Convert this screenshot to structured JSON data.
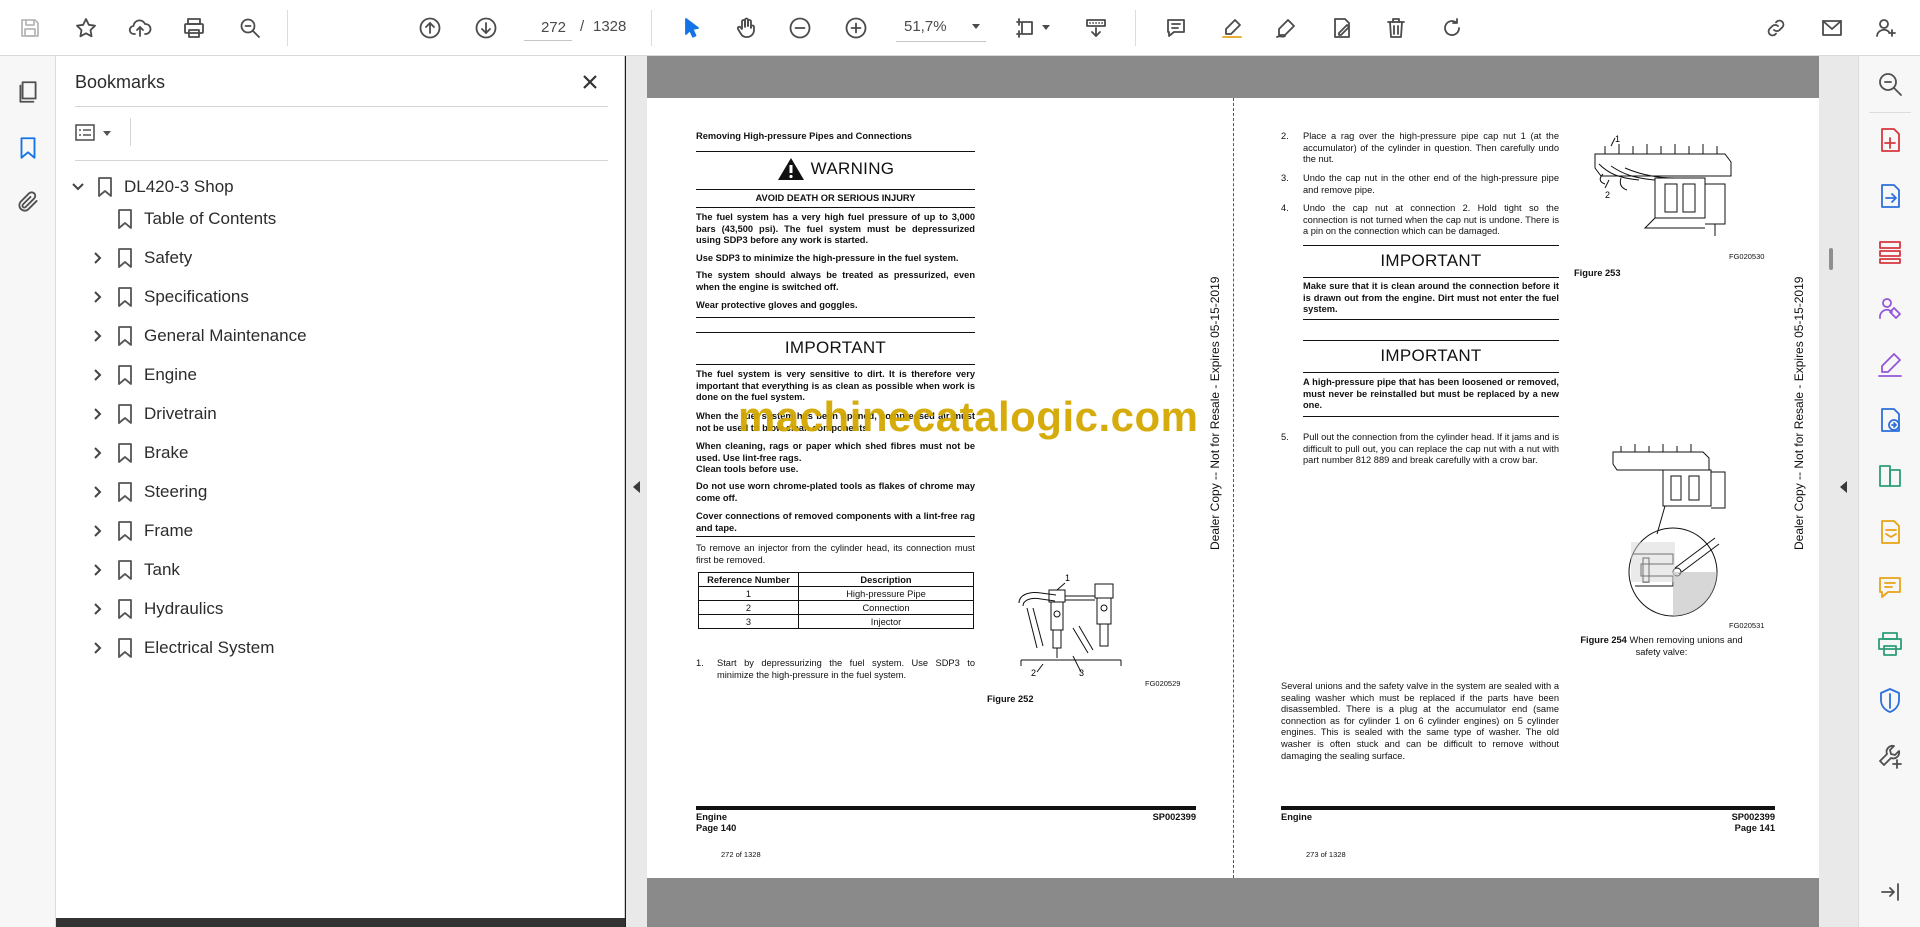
{
  "toolbar": {
    "current_page": "272",
    "page_separator": "/",
    "total_pages": "1328",
    "zoom": "51,7%"
  },
  "bookmarks": {
    "title": "Bookmarks",
    "root": "DL420-3 Shop",
    "items": [
      {
        "label": "Table of Contents",
        "expandable": false
      },
      {
        "label": "Safety",
        "expandable": true
      },
      {
        "label": "Specifications",
        "expandable": true
      },
      {
        "label": "General Maintenance",
        "expandable": true
      },
      {
        "label": "Engine",
        "expandable": true
      },
      {
        "label": "Drivetrain",
        "expandable": true
      },
      {
        "label": "Brake",
        "expandable": true
      },
      {
        "label": "Steering",
        "expandable": true
      },
      {
        "label": "Frame",
        "expandable": true
      },
      {
        "label": "Tank",
        "expandable": true
      },
      {
        "label": "Hydraulics",
        "expandable": true
      },
      {
        "label": "Electrical System",
        "expandable": true
      }
    ]
  },
  "watermark": "machinecatalogic.com",
  "page_left": {
    "section_title": "Removing High-pressure Pipes and Connections",
    "warning_title": "WARNING",
    "warning_subtitle": "AVOID DEATH OR SERIOUS INJURY",
    "warning_paras": [
      "The fuel system has a very high fuel pressure of up to 3,000 bars (43,500 psi). The fuel system must be depressurized using SDP3 before any work is started.",
      "Use SDP3 to minimize the high-pressure in the fuel system.",
      "The system should always be treated as pressurized, even when the engine is switched off.",
      "Wear protective gloves and goggles."
    ],
    "important_title": "IMPORTANT",
    "important_paras": [
      "The fuel system is very sensitive to dirt. It is therefore very important that everything is as clean as possible when work is done on the fuel system.",
      "When the fuel system has been opened, compressed air must not be used to blow clean components.",
      "When cleaning, rags or paper which shed fibres must not be used. Use lint-free rags.",
      "Clean tools before use.",
      "Do not use worn chrome-plated tools as flakes of chrome may come off.",
      "Cover connections of removed components with a lint-free rag and tape."
    ],
    "intro": "To remove an injector from the cylinder head, its connection must first be removed.",
    "table_headers": [
      "Reference Number",
      "Description"
    ],
    "table_rows": [
      [
        "1",
        "High-pressure Pipe"
      ],
      [
        "2",
        "Connection"
      ],
      [
        "3",
        "Injector"
      ]
    ],
    "step1_num": "1.",
    "step1": "Start by depressurizing the fuel system. Use SDP3 to minimize the high-pressure in the fuel system.",
    "figure_code": "FG020529",
    "figure_caption": "Figure 252",
    "callouts": [
      "1",
      "2",
      "3"
    ],
    "footer_section": "Engine",
    "footer_page": "Page 140",
    "footer_code": "SP002399",
    "page_counter": "272 of 1328",
    "side_text": "Dealer Copy -- Not for Resale - Expires 05-15-2019"
  },
  "page_right": {
    "steps": [
      {
        "num": "2.",
        "text": "Place a rag over the high-pressure pipe cap nut 1 (at the accumulator) of the cylinder in question. Then carefully undo the nut."
      },
      {
        "num": "3.",
        "text": "Undo the cap nut in the other end of the high-pressure pipe and remove pipe."
      },
      {
        "num": "4.",
        "text": "Undo the cap nut at connection 2. Hold tight so the connection is not turned when the cap nut is undone. There is a pin on the connection which can be damaged."
      }
    ],
    "important1_title": "IMPORTANT",
    "important1_text": "Make sure that it is clean around the connection before it is drawn out from the engine. Dirt must not enter the fuel system.",
    "important2_title": "IMPORTANT",
    "important2_text": "A high-pressure pipe that has been loosened or removed, must never be reinstalled but must be replaced by a new one.",
    "step5_num": "5.",
    "step5": "Pull out the connection from the cylinder head. If it jams and is difficult to pull out, you can replace the cap nut with a nut with part number 812 889 and break carefully with a crow bar.",
    "fig253_code": "FG020530",
    "fig253_caption": "Figure 253",
    "fig253_callouts": [
      "1",
      "2"
    ],
    "fig254_code": "FG020531",
    "fig254_caption": "Figure 254",
    "fig254_caption_rest": "When removing unions and safety valve:",
    "closing_para": "Several unions and the safety valve in the system are sealed with a sealing washer which must be replaced if the parts have been disassembled. There is a plug at the accumulator end (same connection as for cylinder 1 on 6 cylinder engines) on 5 cylinder engines. This is sealed with the same type of washer. The old washer is often stuck and can be difficult to remove without damaging the sealing surface.",
    "footer_section": "Engine",
    "footer_page": "Page 141",
    "footer_code": "SP002399",
    "page_counter": "273 of 1328",
    "side_text": "Dealer Copy -- Not for Resale - Expires 05-15-2019"
  },
  "colors": {
    "accent": "#1473e6",
    "tool_pink": "#d7373f",
    "tool_blue": "#2d6fdb",
    "tool_green": "#2d9d78",
    "tool_purple": "#9256d9",
    "tool_yellow": "#e8a317",
    "watermark": "#d4a800"
  }
}
